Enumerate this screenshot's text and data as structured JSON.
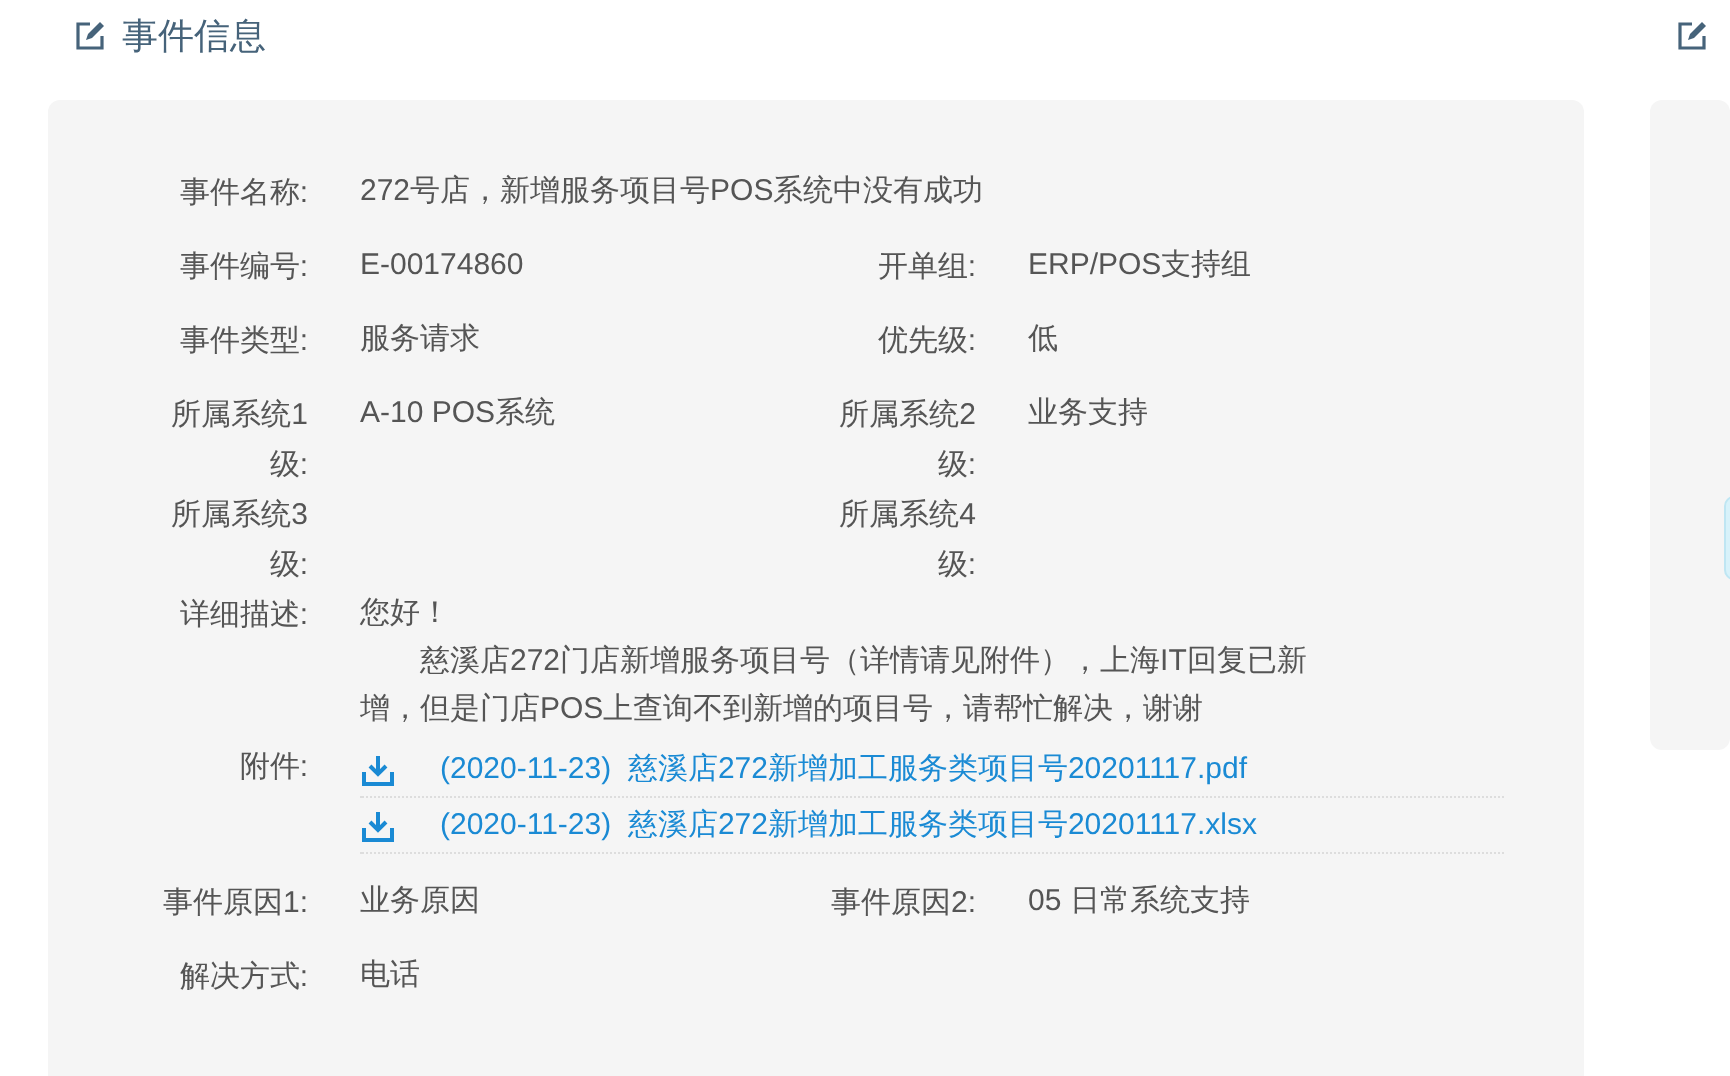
{
  "section": {
    "title": "事件信息"
  },
  "rows": [
    {
      "fields": [
        {
          "label": "事件名称:",
          "value": "272号店，新增服务项目号POS系统中没有成功"
        }
      ]
    },
    {
      "fields": [
        {
          "label": "事件编号:",
          "value": "E-00174860"
        },
        {
          "label": "开单组:",
          "value": "ERP/POS支持组"
        }
      ]
    },
    {
      "fields": [
        {
          "label": "事件类型:",
          "value": "服务请求"
        },
        {
          "label": "优先级:",
          "value": "低"
        }
      ]
    },
    {
      "fields": [
        {
          "label": "所属系统1级:",
          "value": "A-10 POS系统"
        },
        {
          "label": "所属系统2级:",
          "value": "业务支持"
        }
      ]
    },
    {
      "fields": [
        {
          "label": "所属系统3级:"
        },
        {
          "label": "所属系统4级:"
        }
      ]
    },
    {
      "fields": [
        {
          "label": "详细描述:",
          "paragraphs": [
            "您好！",
            "慈溪店272门店新增服务项目号（详情请见附件），上海IT回复已新增，但是门店POS上查询不到新增的项目号，请帮忙解决，谢谢"
          ]
        }
      ]
    },
    {
      "fields": [
        {
          "label": "附件:",
          "attachments": [
            {
              "date": "(2020-11-23)",
              "name": "慈溪店272新增加工服务类项目号20201117.pdf"
            },
            {
              "date": "(2020-11-23)",
              "name": "慈溪店272新增加工服务类项目号20201117.xlsx"
            }
          ]
        }
      ]
    },
    {
      "fields": [
        {
          "label": "事件原因1:",
          "value": "业务原因"
        },
        {
          "label": "事件原因2:",
          "value": "05 日常系统支持"
        }
      ]
    },
    {
      "fields": [
        {
          "label": "解决方式:",
          "value": "电话"
        }
      ]
    }
  ]
}
